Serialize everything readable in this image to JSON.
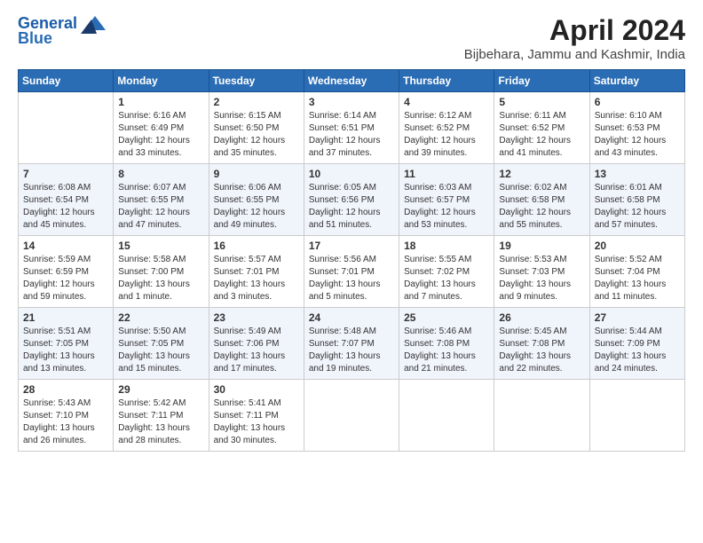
{
  "logo": {
    "line1": "General",
    "line2": "Blue"
  },
  "title": "April 2024",
  "subtitle": "Bijbehara, Jammu and Kashmir, India",
  "days_header": [
    "Sunday",
    "Monday",
    "Tuesday",
    "Wednesday",
    "Thursday",
    "Friday",
    "Saturday"
  ],
  "weeks": [
    [
      {
        "day": "",
        "text": ""
      },
      {
        "day": "1",
        "text": "Sunrise: 6:16 AM\nSunset: 6:49 PM\nDaylight: 12 hours\nand 33 minutes."
      },
      {
        "day": "2",
        "text": "Sunrise: 6:15 AM\nSunset: 6:50 PM\nDaylight: 12 hours\nand 35 minutes."
      },
      {
        "day": "3",
        "text": "Sunrise: 6:14 AM\nSunset: 6:51 PM\nDaylight: 12 hours\nand 37 minutes."
      },
      {
        "day": "4",
        "text": "Sunrise: 6:12 AM\nSunset: 6:52 PM\nDaylight: 12 hours\nand 39 minutes."
      },
      {
        "day": "5",
        "text": "Sunrise: 6:11 AM\nSunset: 6:52 PM\nDaylight: 12 hours\nand 41 minutes."
      },
      {
        "day": "6",
        "text": "Sunrise: 6:10 AM\nSunset: 6:53 PM\nDaylight: 12 hours\nand 43 minutes."
      }
    ],
    [
      {
        "day": "7",
        "text": "Sunrise: 6:08 AM\nSunset: 6:54 PM\nDaylight: 12 hours\nand 45 minutes."
      },
      {
        "day": "8",
        "text": "Sunrise: 6:07 AM\nSunset: 6:55 PM\nDaylight: 12 hours\nand 47 minutes."
      },
      {
        "day": "9",
        "text": "Sunrise: 6:06 AM\nSunset: 6:55 PM\nDaylight: 12 hours\nand 49 minutes."
      },
      {
        "day": "10",
        "text": "Sunrise: 6:05 AM\nSunset: 6:56 PM\nDaylight: 12 hours\nand 51 minutes."
      },
      {
        "day": "11",
        "text": "Sunrise: 6:03 AM\nSunset: 6:57 PM\nDaylight: 12 hours\nand 53 minutes."
      },
      {
        "day": "12",
        "text": "Sunrise: 6:02 AM\nSunset: 6:58 PM\nDaylight: 12 hours\nand 55 minutes."
      },
      {
        "day": "13",
        "text": "Sunrise: 6:01 AM\nSunset: 6:58 PM\nDaylight: 12 hours\nand 57 minutes."
      }
    ],
    [
      {
        "day": "14",
        "text": "Sunrise: 5:59 AM\nSunset: 6:59 PM\nDaylight: 12 hours\nand 59 minutes."
      },
      {
        "day": "15",
        "text": "Sunrise: 5:58 AM\nSunset: 7:00 PM\nDaylight: 13 hours\nand 1 minute."
      },
      {
        "day": "16",
        "text": "Sunrise: 5:57 AM\nSunset: 7:01 PM\nDaylight: 13 hours\nand 3 minutes."
      },
      {
        "day": "17",
        "text": "Sunrise: 5:56 AM\nSunset: 7:01 PM\nDaylight: 13 hours\nand 5 minutes."
      },
      {
        "day": "18",
        "text": "Sunrise: 5:55 AM\nSunset: 7:02 PM\nDaylight: 13 hours\nand 7 minutes."
      },
      {
        "day": "19",
        "text": "Sunrise: 5:53 AM\nSunset: 7:03 PM\nDaylight: 13 hours\nand 9 minutes."
      },
      {
        "day": "20",
        "text": "Sunrise: 5:52 AM\nSunset: 7:04 PM\nDaylight: 13 hours\nand 11 minutes."
      }
    ],
    [
      {
        "day": "21",
        "text": "Sunrise: 5:51 AM\nSunset: 7:05 PM\nDaylight: 13 hours\nand 13 minutes."
      },
      {
        "day": "22",
        "text": "Sunrise: 5:50 AM\nSunset: 7:05 PM\nDaylight: 13 hours\nand 15 minutes."
      },
      {
        "day": "23",
        "text": "Sunrise: 5:49 AM\nSunset: 7:06 PM\nDaylight: 13 hours\nand 17 minutes."
      },
      {
        "day": "24",
        "text": "Sunrise: 5:48 AM\nSunset: 7:07 PM\nDaylight: 13 hours\nand 19 minutes."
      },
      {
        "day": "25",
        "text": "Sunrise: 5:46 AM\nSunset: 7:08 PM\nDaylight: 13 hours\nand 21 minutes."
      },
      {
        "day": "26",
        "text": "Sunrise: 5:45 AM\nSunset: 7:08 PM\nDaylight: 13 hours\nand 22 minutes."
      },
      {
        "day": "27",
        "text": "Sunrise: 5:44 AM\nSunset: 7:09 PM\nDaylight: 13 hours\nand 24 minutes."
      }
    ],
    [
      {
        "day": "28",
        "text": "Sunrise: 5:43 AM\nSunset: 7:10 PM\nDaylight: 13 hours\nand 26 minutes."
      },
      {
        "day": "29",
        "text": "Sunrise: 5:42 AM\nSunset: 7:11 PM\nDaylight: 13 hours\nand 28 minutes."
      },
      {
        "day": "30",
        "text": "Sunrise: 5:41 AM\nSunset: 7:11 PM\nDaylight: 13 hours\nand 30 minutes."
      },
      {
        "day": "",
        "text": ""
      },
      {
        "day": "",
        "text": ""
      },
      {
        "day": "",
        "text": ""
      },
      {
        "day": "",
        "text": ""
      }
    ]
  ]
}
